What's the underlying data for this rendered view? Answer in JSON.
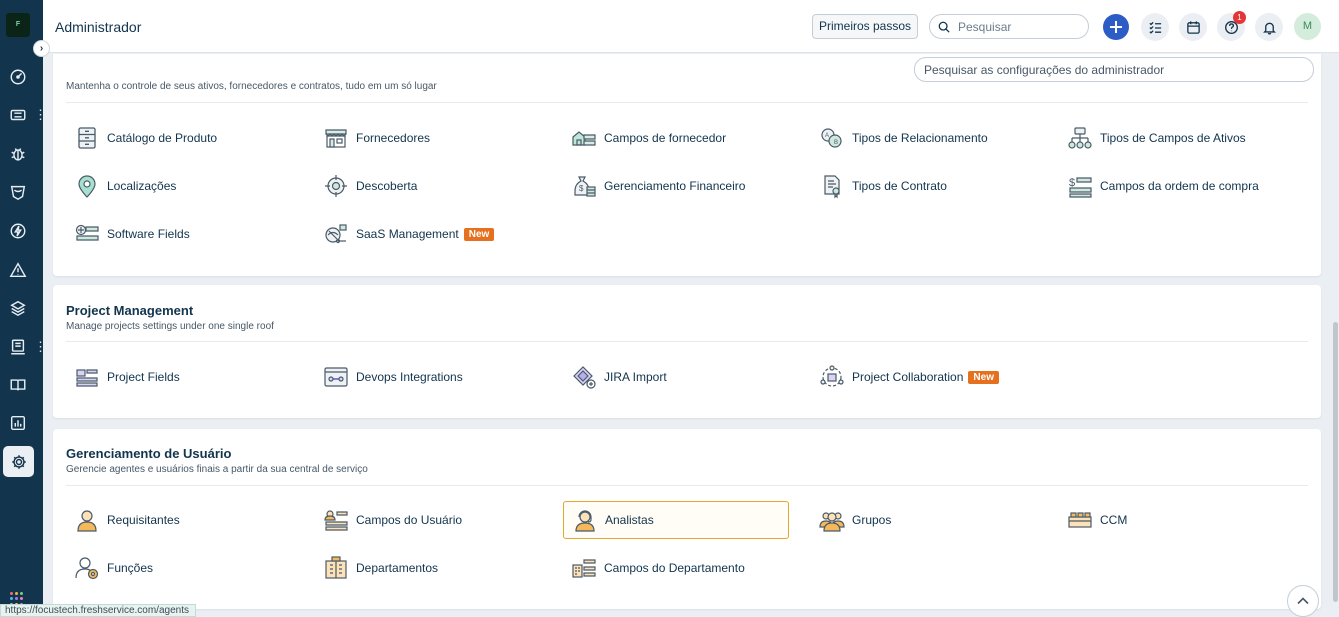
{
  "header": {
    "title": "Administrador",
    "first_steps": "Primeiros passos",
    "search_placeholder": "Pesquisar",
    "help_badge": "1",
    "avatar_initial": "M"
  },
  "leftnav": {
    "logo_text": "F",
    "icons": [
      "dashboard-icon",
      "tickets-icon",
      "problems-icon",
      "changes-icon",
      "releases-icon",
      "alerts-icon",
      "assets-icon",
      "contracts-icon",
      "solutions-icon",
      "reports-icon",
      "admin-gear-icon"
    ],
    "collapse_glyph": "›"
  },
  "admin_search_placeholder": "Pesquisar as configurações do administrador",
  "sections": {
    "assets": {
      "subtitle": "Mantenha o controle de seus ativos, fornecedores e contratos, tudo em um só lugar",
      "items": [
        {
          "label": "Catálogo de Produto",
          "icon": "product-catalog-icon"
        },
        {
          "label": "Fornecedores",
          "icon": "vendors-icon"
        },
        {
          "label": "Campos de fornecedor",
          "icon": "vendor-fields-icon"
        },
        {
          "label": "Tipos de Relacionamento",
          "icon": "relationship-types-icon"
        },
        {
          "label": "Tipos de Campos de Ativos",
          "icon": "asset-types-icon"
        },
        {
          "label": "Localizações",
          "icon": "location-pin-icon"
        },
        {
          "label": "Descoberta",
          "icon": "discovery-icon"
        },
        {
          "label": "Gerenciamento Financeiro",
          "icon": "finance-icon"
        },
        {
          "label": "Tipos de Contrato",
          "icon": "contract-types-icon"
        },
        {
          "label": "Campos da ordem de compra",
          "icon": "purchase-order-fields-icon"
        },
        {
          "label": "Software Fields",
          "icon": "software-fields-icon"
        },
        {
          "label": "SaaS Management",
          "icon": "saas-management-icon",
          "tag": "New"
        }
      ]
    },
    "project": {
      "title": "Project Management",
      "subtitle": "Manage projects settings under one single roof",
      "items": [
        {
          "label": "Project Fields",
          "icon": "project-fields-icon"
        },
        {
          "label": "Devops Integrations",
          "icon": "devops-icon"
        },
        {
          "label": "JIRA Import",
          "icon": "jira-import-icon"
        },
        {
          "label": "Project Collaboration",
          "icon": "collaboration-icon",
          "tag": "New"
        }
      ]
    },
    "users": {
      "title": "Gerenciamento de Usuário",
      "subtitle": "Gerencie agentes e usuários finais a partir da sua central de serviço",
      "items": [
        {
          "label": "Requisitantes",
          "icon": "requesters-icon"
        },
        {
          "label": "Campos do Usuário",
          "icon": "user-fields-icon"
        },
        {
          "label": "Analistas",
          "icon": "agents-icon"
        },
        {
          "label": "Grupos",
          "icon": "groups-icon"
        },
        {
          "label": "CCM",
          "icon": "ccm-icon"
        },
        {
          "label": "Funções",
          "icon": "roles-icon"
        },
        {
          "label": "Departamentos",
          "icon": "departments-icon"
        },
        {
          "label": "Campos do Departamento",
          "icon": "department-fields-icon"
        }
      ]
    }
  },
  "status_url": "https://focustech.freshservice.com/agents",
  "colors": {
    "nav": "#12344d",
    "accent": "#2c5cc5",
    "new_tag": "#e5701f",
    "selected_border": "#e0a82e"
  }
}
